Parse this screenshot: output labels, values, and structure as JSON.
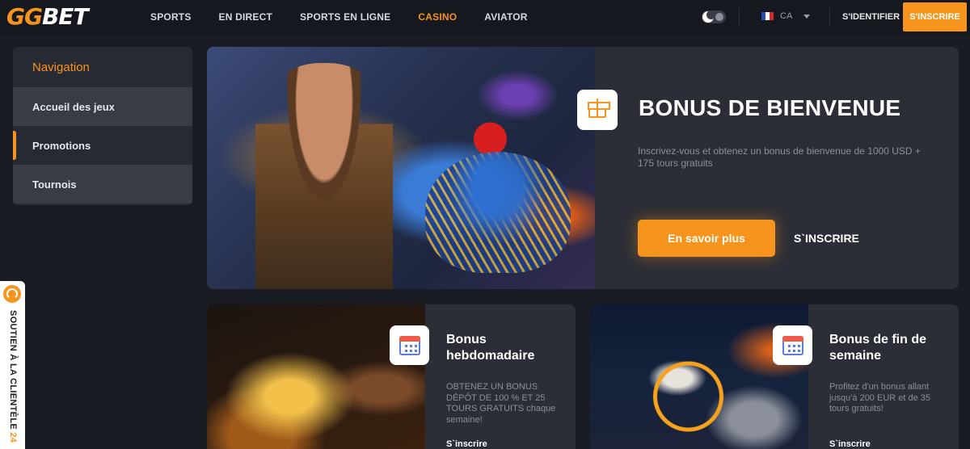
{
  "header": {
    "logo": {
      "left": "GG",
      "right": "BET"
    },
    "nav": [
      "SPORTS",
      "EN DIRECT",
      "SPORTS EN LIGNE",
      "CASINO",
      "AVIATOR"
    ],
    "active_nav": "CASINO",
    "lang": "CA",
    "login": "S'IDENTIFIER",
    "signup": "S'INSCRIRE"
  },
  "sidebar": {
    "title": "Navigation",
    "items": [
      {
        "label": "Accueil des jeux"
      },
      {
        "label": "Promotions"
      },
      {
        "label": "Tournois"
      }
    ]
  },
  "support": {
    "label": "SOUTIEN À LA CLIENTÈLE",
    "hours": "24"
  },
  "hero": {
    "title": "BONUS DE BIENVENUE",
    "description": "Inscrivez-vous et obtenez un bonus de bienvenue de 1000 USD + 175 tours gratuits",
    "primary_button": "En savoir plus",
    "secondary_button": "S`INSCRIRE"
  },
  "promos": [
    {
      "title": "Bonus hebdomadaire",
      "description": "OBTENEZ UN BONUS DÉPÔT DE 100 % ET 25 TOURS GRATUITS chaque semaine!",
      "link": "S`inscrire"
    },
    {
      "title": "Bonus de fin de semaine",
      "description": "Profitez d'un bonus allant jusqu'à 200 EUR et de 35 tours gratuits!",
      "link": "S`inscrire"
    }
  ],
  "colors": {
    "accent": "#f7941d",
    "background": "#1a1c24",
    "card": "#2c2e37"
  },
  "icons": [
    "moon-icon",
    "flag-icon",
    "chevron-down-icon",
    "headset-icon",
    "gift-icon",
    "calendar-icon"
  ]
}
